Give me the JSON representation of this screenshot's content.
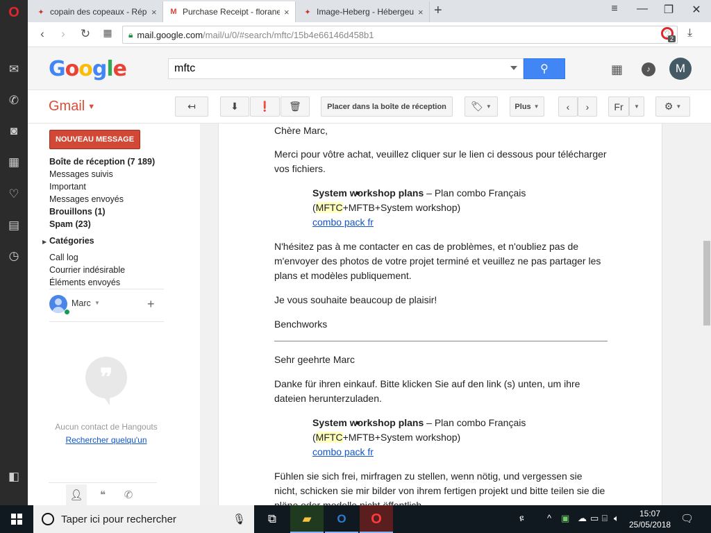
{
  "browser": {
    "tabs": [
      {
        "title": "copain des copeaux - Répo",
        "favicon": "butterfly-icon"
      },
      {
        "title": "Purchase Receipt - florane",
        "favicon": "gmail-icon"
      },
      {
        "title": "Image-Heberg - Hébergeur",
        "favicon": "butterfly-icon"
      }
    ],
    "url_host": "mail.google.com",
    "url_path": "/mail/u/0/#search/mftc/15b4e66146d458b1",
    "adblock_count": "2"
  },
  "google": {
    "logo": "Google",
    "search_value": "mftc",
    "avatar_letter": "M"
  },
  "gmail": {
    "label": "Gmail",
    "toolbar": {
      "move_to_inbox": "Placer dans la boîte de réception",
      "more": "Plus",
      "lang": "Fr"
    },
    "compose": "NOUVEAU MESSAGE",
    "nav": [
      {
        "label": "Boîte de réception (7 189)",
        "bold": true
      },
      {
        "label": "Messages suivis",
        "bold": false
      },
      {
        "label": "Important",
        "bold": false
      },
      {
        "label": "Messages envoyés",
        "bold": false
      },
      {
        "label": "Brouillons (1)",
        "bold": true
      },
      {
        "label": "Spam (23)",
        "bold": true
      }
    ],
    "categories": "Catégories",
    "labels": [
      "Call log",
      "Courrier indésirable",
      "Éléments envoyés"
    ],
    "hangouts": {
      "user": "Marc",
      "no_contacts": "Aucun contact de Hangouts",
      "search_someone": "Rechercher quelqu'un"
    }
  },
  "message": {
    "fr": {
      "greeting": "Chère Marc,",
      "p1": "Merci pour vôtre achat, veuillez cliquer sur le lien ci dessous pour télécharger vos fichiers.",
      "item_bold": "System workshop plans",
      "item_rest": " – Plan combo Français",
      "item_paren_open": "(",
      "item_hl": "MFTC",
      "item_paren_rest": "+MFTB+System workshop)",
      "item_link": "combo pack fr",
      "p2": "N'hésitez pas à me contacter en cas de problèmes, et n'oubliez pas de m'envoyer des photos de votre projet terminé et veuillez ne pas partager les plans et modèles publiquement.",
      "p3": "Je vous souhaite beaucoup de plaisir!",
      "signature": "Benchworks"
    },
    "de": {
      "greeting": "Sehr geehrte Marc",
      "p1": "Danke für ihren einkauf. Bitte klicken Sie auf den link (s) unten, um ihre dateien herunterzuladen.",
      "item_bold": "System workshop plans",
      "item_rest": " – Plan combo Français",
      "item_paren_open": "(",
      "item_hl": "MFTC",
      "item_paren_rest": "+MFTB+System workshop)",
      "item_link": "combo pack fr",
      "p2": "Fühlen sie sich frei, mirfragen zu stellen, wenn nötig, und vergessen sie nicht, schicken sie mir bilder von ihrem fertigen projekt und bitte teilen sie die pläne oder modelle nicht öffentlich."
    }
  },
  "taskbar": {
    "search_placeholder": "Taper ici pour rechercher",
    "time": "15:07",
    "date": "25/05/2018"
  }
}
